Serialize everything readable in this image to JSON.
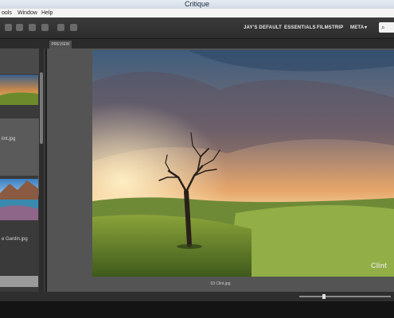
{
  "window": {
    "title": "Critique"
  },
  "menu": {
    "items": [
      "ools",
      "Window",
      "Help"
    ]
  },
  "workspaces": [
    "JAY'S DEFAULT",
    "ESSENTIALS",
    "FILMSTRIP",
    "META"
  ],
  "toolbar": {
    "search_icon": "search-icon",
    "search_menu": "▾"
  },
  "tabs": {
    "preview": "PREVIEW"
  },
  "filmstrip": {
    "items": [
      {
        "name": "lint.jpg"
      },
      {
        "name": "e Gardin.jpg"
      }
    ]
  },
  "preview": {
    "caption": "03 Clint.jpg",
    "watermark": "Clint"
  },
  "statusbar": {
    "zoom_fraction": 0.27
  }
}
